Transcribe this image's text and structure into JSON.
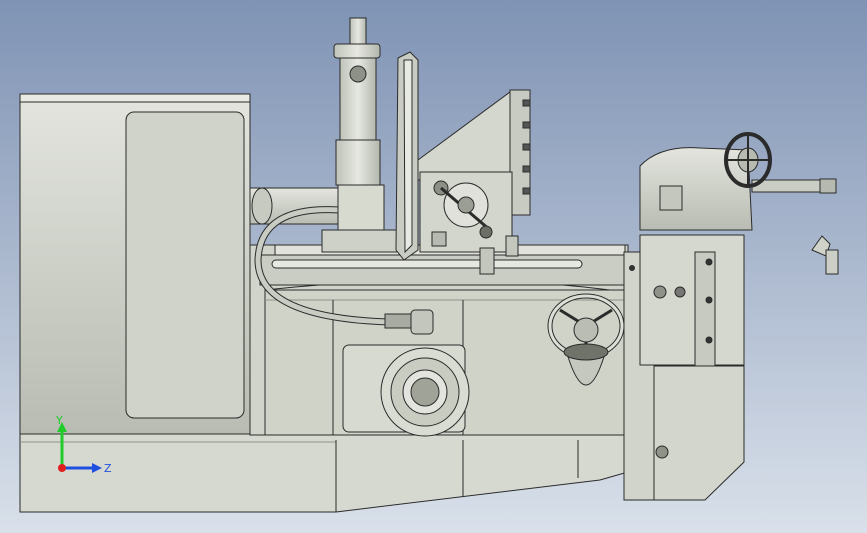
{
  "viewport": {
    "background_top": "#7f93b4",
    "background_bottom": "#d9e0ea"
  },
  "model": {
    "body_color": "#d2d6cc",
    "edge_color": "#2b2b2b",
    "shade_color": "#a9ada3",
    "highlight_color": "#eef0ea"
  },
  "triad": {
    "x_axis_label": "",
    "y_axis_label": "Y",
    "z_axis_label": "Z",
    "y_color": "#1fcc2a",
    "z_color": "#1f4fe0",
    "x_color": "#e01f1f"
  }
}
